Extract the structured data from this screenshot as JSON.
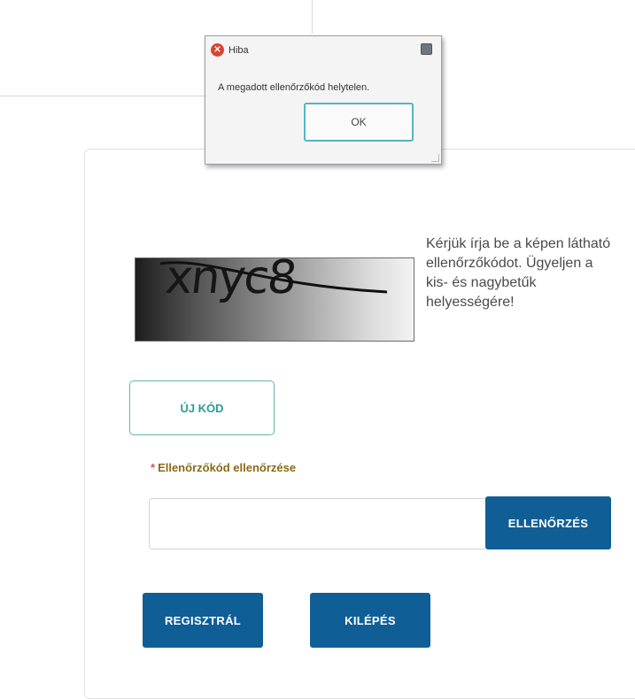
{
  "dialog": {
    "title": "Hiba",
    "message": "A megadott ellenőrzőkód helytelen.",
    "ok_label": "OK",
    "icon": "error-icon"
  },
  "captcha": {
    "text": "xnyc8"
  },
  "hint": "Kérjük írja be a képen látható ellenőrzőkódot. Ügyeljen a kis- és nagybetűk helyességére!",
  "new_code_label": "ÚJ KÓD",
  "field": {
    "required_mark": "*",
    "label": "Ellenőrzőkód ellenőrzése",
    "value": ""
  },
  "buttons": {
    "check_label": "ELLENŐRZÉS",
    "register_label": "REGISZTRÁL",
    "exit_label": "KILÉPÉS"
  },
  "colors": {
    "primary": "#0f5f96",
    "accent": "#2a9d96",
    "label": "#8a6a15",
    "error": "#d9452f"
  }
}
